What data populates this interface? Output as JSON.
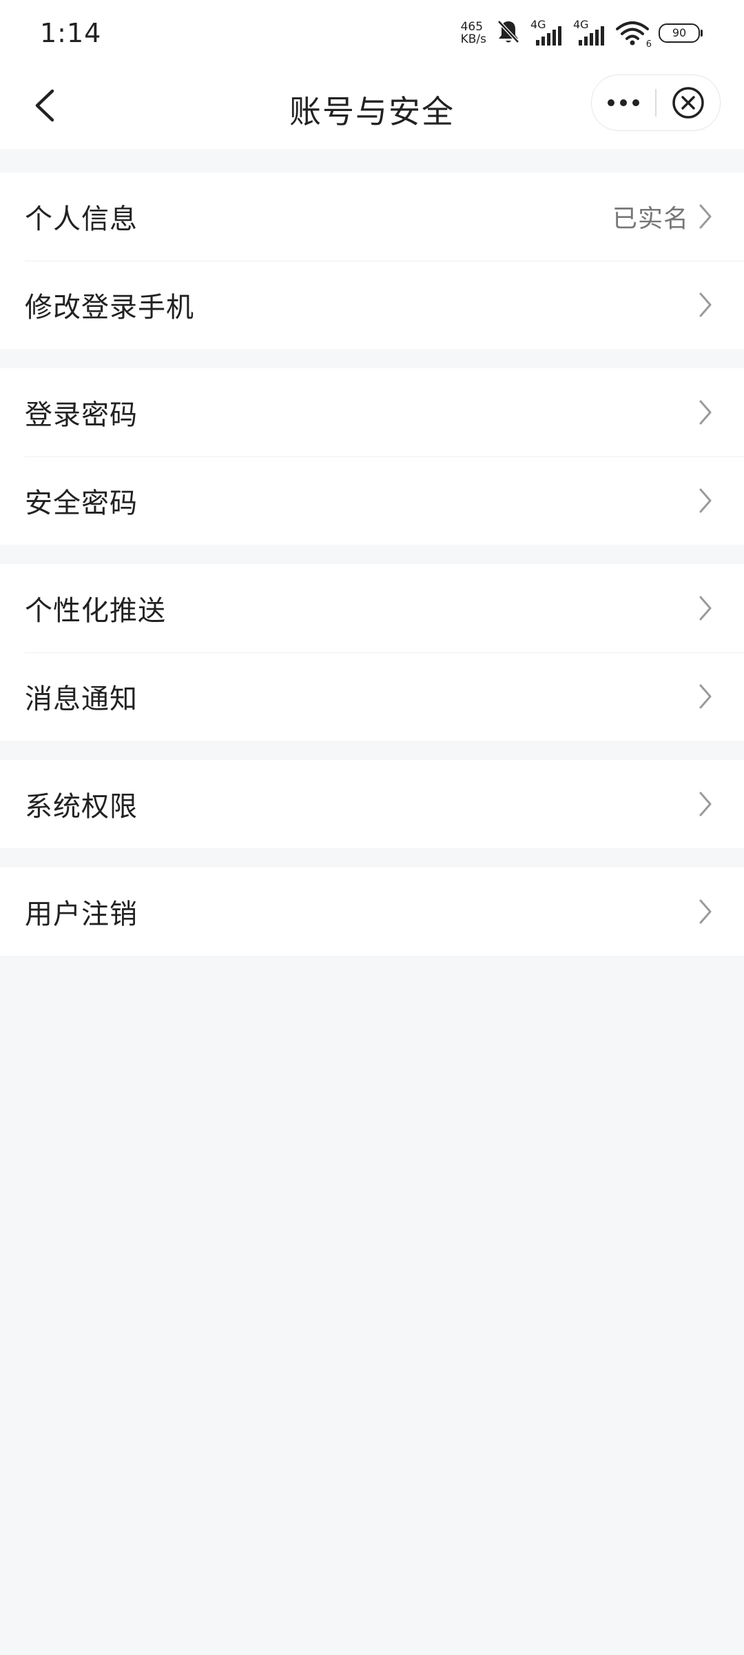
{
  "status": {
    "time": "1:14",
    "speed_value": "465",
    "speed_unit": "KB/s",
    "sim1": "4G",
    "sim2": "4G",
    "wifi_badge": "6",
    "battery": "90"
  },
  "header": {
    "title": "账号与安全"
  },
  "groups": [
    [
      {
        "label": "个人信息",
        "value": "已实名"
      },
      {
        "label": "修改登录手机",
        "value": ""
      }
    ],
    [
      {
        "label": "登录密码",
        "value": ""
      },
      {
        "label": "安全密码",
        "value": ""
      }
    ],
    [
      {
        "label": "个性化推送",
        "value": ""
      },
      {
        "label": "消息通知",
        "value": ""
      }
    ],
    [
      {
        "label": "系统权限",
        "value": ""
      }
    ],
    [
      {
        "label": "用户注销",
        "value": ""
      }
    ]
  ],
  "colors": {
    "background": "#f6f7f9",
    "surface": "#ffffff",
    "text": "#222222",
    "secondary_text": "#777777",
    "chevron": "#9a9a9a"
  }
}
